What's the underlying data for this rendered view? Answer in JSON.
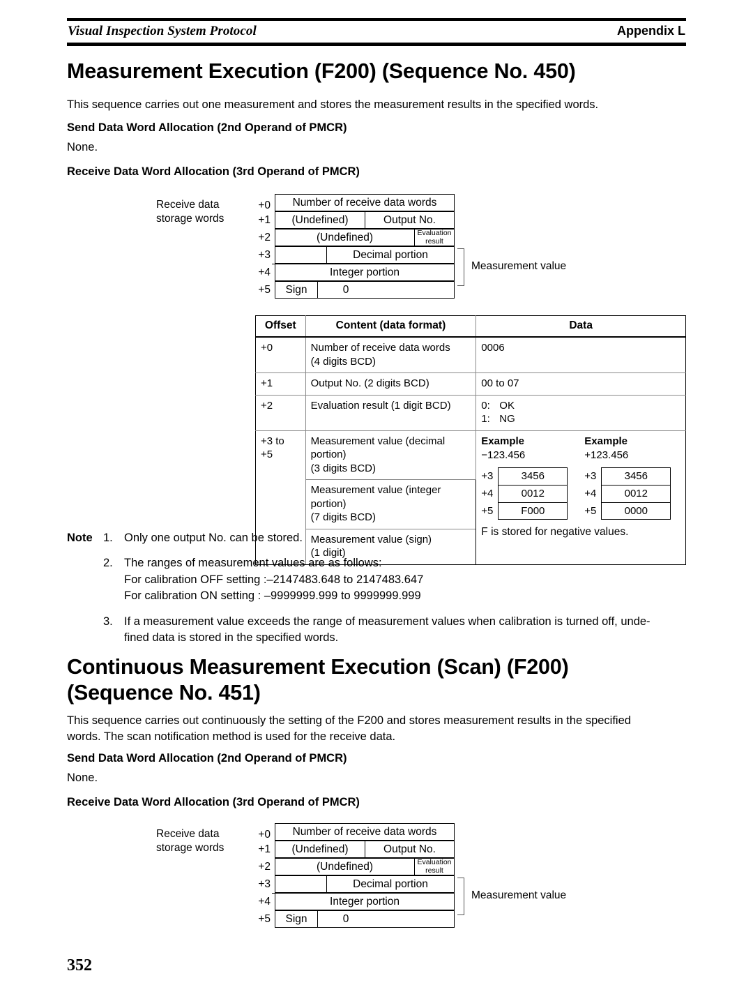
{
  "header": {
    "left_title": "Visual Inspection System Protocol",
    "right_title": "Appendix L"
  },
  "section1": {
    "heading": "Measurement Execution (F200) (Sequence No. 450)",
    "intro": "This sequence carries out one measurement and stores the measurement results in the specified words.",
    "send_heading": "Send Data Word Allocation (2nd Operand of PMCR)",
    "send_value": "None.",
    "receive_heading": "Receive Data Word Allocation (3rd Operand of PMCR)"
  },
  "diagram": {
    "side_label_line1": "Receive data",
    "side_label_line2": "storage words",
    "offsets": [
      "+0",
      "+1",
      "+2",
      "+3",
      "+4",
      "+5"
    ],
    "row0": "Number of receive data words",
    "row1_left": "(Undefined)",
    "row1_right": "Output No.",
    "row2_left": "(Undefined)",
    "row2_right_line1": "Evaluation",
    "row2_right_line2": "result",
    "row3": "Decimal portion",
    "row4": "Integer portion",
    "row5_sign": "Sign",
    "row5_zero": "0",
    "brace_label": "Measurement value"
  },
  "table": {
    "columns": [
      "Offset",
      "Content (data format)",
      "Data"
    ],
    "rows": [
      {
        "offset": "+0",
        "content_line1": "Number of receive data words",
        "content_line2": "(4 digits BCD)",
        "data": "0006"
      },
      {
        "offset": "+1",
        "content_line1": "Output No. (2 digits BCD)",
        "content_line2": "",
        "data": "00 to 07"
      },
      {
        "offset": "+2",
        "content_line1": "Evaluation result (1 digit BCD)",
        "content_line2": "",
        "data_pairs": [
          {
            "key": "0:",
            "val": "OK"
          },
          {
            "key": "1:",
            "val": "NG"
          }
        ]
      }
    ],
    "measurement_group": {
      "offset_line1": "+3 to",
      "offset_line2": "+5",
      "content_rows": [
        {
          "line1": "Measurement value (decimal portion)",
          "line2": "(3 digits BCD)"
        },
        {
          "line1": "Measurement value (integer portion)",
          "line2": "(7 digits BCD)"
        },
        {
          "line1": "Measurement value (sign)",
          "line2": "(1 digit)"
        }
      ],
      "examples": [
        {
          "title": "Example",
          "value": "−123.456",
          "rows": [
            {
              "offset": "+3",
              "word": "3456"
            },
            {
              "offset": "+4",
              "word": "0012"
            },
            {
              "offset": "+5",
              "word": "F000"
            }
          ]
        },
        {
          "title": "Example",
          "value": "+123.456",
          "rows": [
            {
              "offset": "+3",
              "word": "3456"
            },
            {
              "offset": "+4",
              "word": "0012"
            },
            {
              "offset": "+5",
              "word": "0000"
            }
          ]
        }
      ],
      "footnote": "F is stored for negative values."
    }
  },
  "notes": {
    "label": "Note",
    "items": [
      {
        "num": "1.",
        "lines": [
          "Only one output No. can be stored."
        ]
      },
      {
        "num": "2.",
        "lines": [
          "The ranges of measurement values are as follows:",
          "For calibration OFF setting :–2147483.648 to 2147483.647",
          "For calibration ON setting :  –9999999.999 to 9999999.999"
        ]
      },
      {
        "num": "3.",
        "lines": [
          "If a measurement value exceeds the range of measurement values when calibration is turned off, unde-",
          "fined data is stored in the specified words."
        ]
      }
    ]
  },
  "section2": {
    "heading_line1": "Continuous Measurement Execution (Scan) (F200)",
    "heading_line2": "(Sequence No. 451)",
    "intro_line1": "This sequence carries out continuously the setting of the F200 and stores measurement results in the specified",
    "intro_line2": "words. The scan notification method is used for the receive data.",
    "send_heading": "Send Data Word Allocation (2nd Operand of PMCR)",
    "send_value": "None.",
    "receive_heading": "Receive Data Word Allocation (3rd Operand of PMCR)"
  },
  "page_number": "352"
}
